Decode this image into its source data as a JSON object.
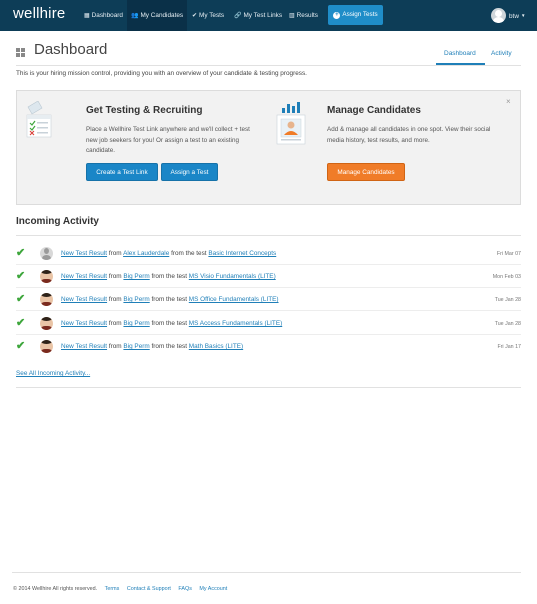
{
  "brand": "wellhire",
  "nav": {
    "items": [
      {
        "label": "Dashboard",
        "icon": "grid-icon"
      },
      {
        "label": "My Candidates",
        "icon": "users-icon"
      },
      {
        "label": "My Tests",
        "icon": "check-icon"
      },
      {
        "label": "My Test Links",
        "icon": "link-icon"
      },
      {
        "label": "Results",
        "icon": "chart-icon"
      }
    ],
    "assign_button": "Assign Tests",
    "user": "btw"
  },
  "header": {
    "title": "Dashboard",
    "tabs": [
      "Dashboard",
      "Activity"
    ],
    "intro": "This is your hiring mission control, providing you with an overview of your candidate & testing progress."
  },
  "panel": {
    "testing": {
      "title": "Get Testing & Recruiting",
      "text": "Place a Wellhire Test Link anywhere and we'll collect + test new job seekers for you! Or assign a test to an existing candidate.",
      "btn_link": "Create a Test Link",
      "btn_assign": "Assign a Test"
    },
    "candidates": {
      "title": "Manage Candidates",
      "text": "Add & manage all candidates in one spot. View their social media history, test results, and more.",
      "btn": "Manage Candidates"
    },
    "close": "×"
  },
  "activity": {
    "title": "Incoming Activity",
    "rows": [
      {
        "result": "New Test Result",
        "from": "from",
        "name": "Alex Lauderdale",
        "mid": "from the test",
        "test": "Basic Internet Concepts",
        "date": "Fri Mar 07"
      },
      {
        "result": "New Test Result",
        "from": "from",
        "name": "Big Perm",
        "mid": "from the test",
        "test": "MS Visio Fundamentals (LITE)",
        "date": "Mon Feb 03"
      },
      {
        "result": "New Test Result",
        "from": "from",
        "name": "Big Perm",
        "mid": "from the test",
        "test": "MS Office Fundamentals (LITE)",
        "date": "Tue Jan 28"
      },
      {
        "result": "New Test Result",
        "from": "from",
        "name": "Big Perm",
        "mid": "from the test",
        "test": "MS Access Fundamentals (LITE)",
        "date": "Tue Jan 28"
      },
      {
        "result": "New Test Result",
        "from": "from",
        "name": "Big Perm",
        "mid": "from the test",
        "test": "Math Basics (LITE)",
        "date": "Fri Jan 17"
      }
    ],
    "see_all": "See All Incoming Activity..."
  },
  "footer": {
    "copyright": "© 2014 Wellhire All rights reserved.",
    "links": [
      "Terms",
      "Contact & Support",
      "FAQs",
      "My Account"
    ]
  }
}
